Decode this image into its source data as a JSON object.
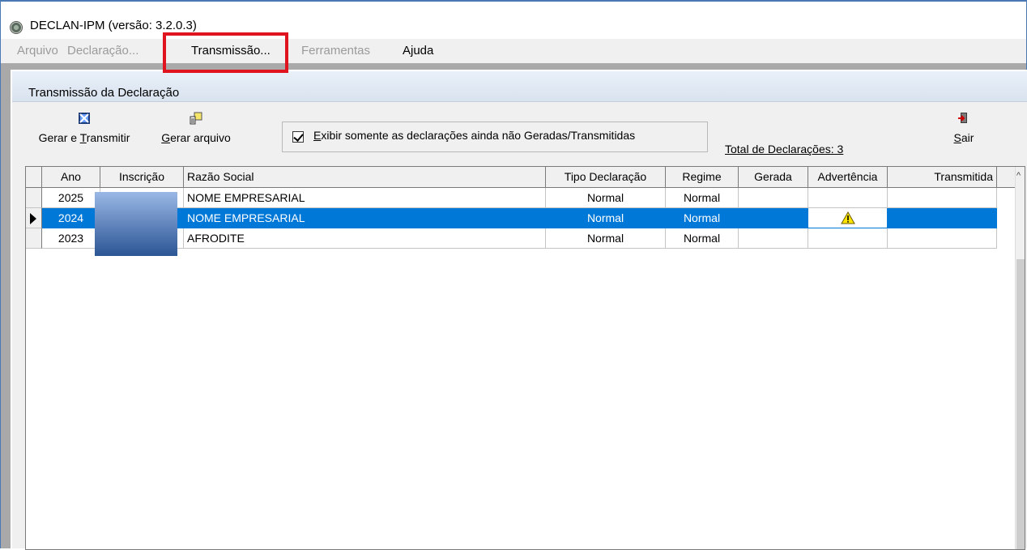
{
  "window": {
    "title": "DECLAN-IPM (versão: 3.2.0.3)"
  },
  "menu": {
    "items": [
      {
        "label": "Arquivo",
        "enabled": false
      },
      {
        "label": "Declaração...",
        "enabled": false
      },
      {
        "label": "Transmissão...",
        "enabled": true,
        "highlighted": true
      },
      {
        "label": "Ferramentas",
        "enabled": false
      },
      {
        "label": "Ajuda",
        "enabled": true
      }
    ]
  },
  "child_window": {
    "title": "Transmissão da Declaração"
  },
  "toolbar": {
    "gerar_transmitir_prefix": "Gerar e ",
    "gerar_transmitir_accel": "T",
    "gerar_transmitir_suffix": "ransmitir",
    "gerar_arquivo_accel": "G",
    "gerar_arquivo_suffix": "erar arquivo",
    "sair_accel": "S",
    "sair_suffix": "air",
    "checkbox_accel": "E",
    "checkbox_suffix": "xibir somente as declarações ainda não Geradas/Transmitidas",
    "checkbox_checked": true,
    "total_label": "Total de Declarações: 3"
  },
  "grid": {
    "columns": [
      "Ano",
      "Inscrição",
      "Razão Social",
      "Tipo Declaração",
      "Regime",
      "Gerada",
      "Advertência",
      "Transmitida"
    ],
    "rows": [
      {
        "ano": "2025",
        "inscricao": "",
        "razao": "NOME EMPRESARIAL",
        "tipo": "Normal",
        "regime": "Normal",
        "gerada": "",
        "advertencia": "",
        "transmitida": "",
        "selected": false
      },
      {
        "ano": "2024",
        "inscricao": "",
        "razao": "NOME EMPRESARIAL",
        "tipo": "Normal",
        "regime": "Normal",
        "gerada": "",
        "advertencia": "warning-icon",
        "transmitida": "",
        "selected": true
      },
      {
        "ano": "2023",
        "inscricao": "",
        "razao": "AFRODITE",
        "tipo": "Normal",
        "regime": "Normal",
        "gerada": "",
        "advertencia": "",
        "transmitida": "",
        "selected": false
      }
    ]
  },
  "colors": {
    "selection": "#0078d7",
    "highlight_box": "#e0141e",
    "title_border": "#4a78b5"
  }
}
